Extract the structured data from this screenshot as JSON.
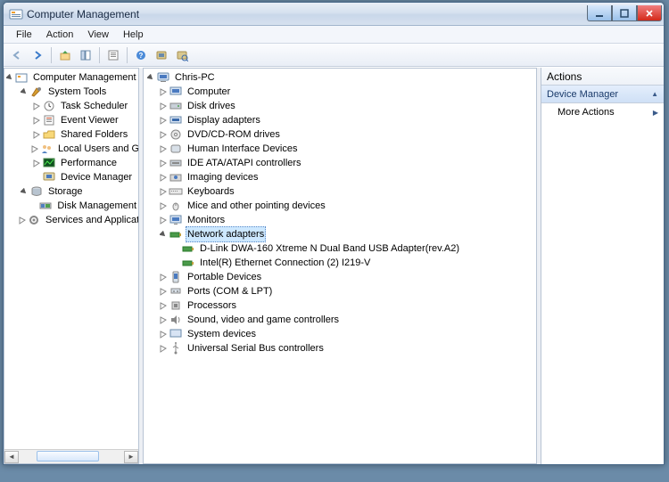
{
  "window": {
    "title": "Computer Management"
  },
  "menu": {
    "file": "File",
    "action": "Action",
    "view": "View",
    "help": "Help"
  },
  "actions": {
    "header": "Actions",
    "sub": "Device Manager",
    "more": "More Actions"
  },
  "leftTree": {
    "root": "Computer Management (Local",
    "systemTools": "System Tools",
    "taskScheduler": "Task Scheduler",
    "eventViewer": "Event Viewer",
    "sharedFolders": "Shared Folders",
    "localUsers": "Local Users and Groups",
    "performance": "Performance",
    "deviceManager": "Device Manager",
    "storage": "Storage",
    "diskManagement": "Disk Management",
    "servicesApps": "Services and Applications"
  },
  "devTree": {
    "root": "Chris-PC",
    "computer": "Computer",
    "diskDrives": "Disk drives",
    "displayAdapters": "Display adapters",
    "dvd": "DVD/CD-ROM drives",
    "hid": "Human Interface Devices",
    "ide": "IDE ATA/ATAPI controllers",
    "imaging": "Imaging devices",
    "keyboards": "Keyboards",
    "mice": "Mice and other pointing devices",
    "monitors": "Monitors",
    "network": "Network adapters",
    "net1": "D-Link DWA-160 Xtreme N Dual Band USB Adapter(rev.A2)",
    "net2": "Intel(R) Ethernet Connection (2) I219-V",
    "portable": "Portable Devices",
    "ports": "Ports (COM & LPT)",
    "processors": "Processors",
    "sound": "Sound, video and game controllers",
    "sysdev": "System devices",
    "usb": "Universal Serial Bus controllers"
  }
}
